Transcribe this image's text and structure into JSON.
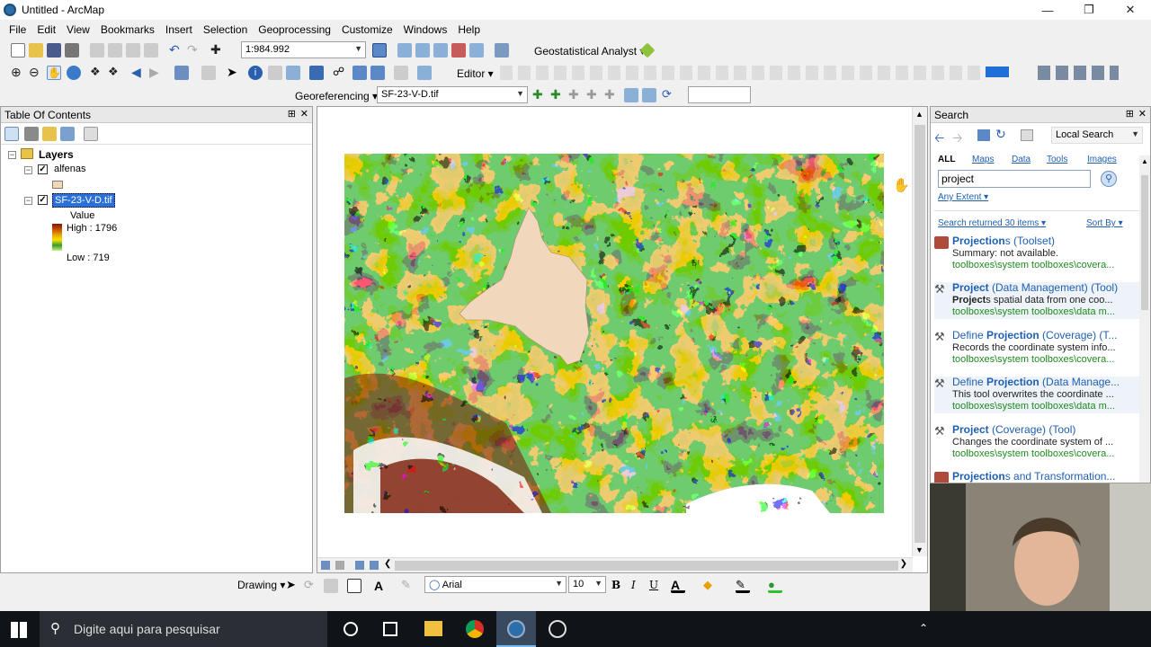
{
  "window": {
    "title": "Untitled - ArcMap"
  },
  "menu": [
    "File",
    "Edit",
    "View",
    "Bookmarks",
    "Insert",
    "Selection",
    "Geoprocessing",
    "Customize",
    "Windows",
    "Help"
  ],
  "toolbar1": {
    "scale": "1:984.992",
    "geostat": "Geostatistical Analyst ▾"
  },
  "toolbar2": {
    "editor": "Editor ▾"
  },
  "toolbar3": {
    "georef_label": "Georeferencing ▾",
    "georef_layer": "SF-23-V-D.tif"
  },
  "toc": {
    "title": "Table Of Contents",
    "root": "Layers",
    "layers": [
      {
        "name": "alfenas"
      },
      {
        "name": "SF-23-V-D.tif",
        "field": "Value",
        "high": "High : 1796",
        "low": "Low : 719"
      }
    ]
  },
  "search": {
    "title": "Search",
    "scope": "Local Search",
    "tabs": [
      "ALL",
      "Maps",
      "Data",
      "Tools",
      "Images"
    ],
    "query": "project",
    "extent": "Any Extent ▾",
    "count": "Search returned 30 items ▾",
    "sort": "Sort By ▾",
    "results": [
      {
        "title_b": "Projection",
        "title_rest": "s (Toolset)",
        "summary": "Summary: not available.",
        "path": "toolboxes\\system toolboxes\\covera..."
      },
      {
        "title_b": "Project",
        "title_rest": " (Data Management) (Tool)",
        "summary_b": "Project",
        "summary": "s spatial data from one coo...",
        "path": "toolboxes\\system toolboxes\\data m..."
      },
      {
        "title_pre": "Define ",
        "title_b": "Projection",
        "title_rest": " (Coverage) (T...",
        "summary": "Records the coordinate system info...",
        "path": "toolboxes\\system toolboxes\\covera..."
      },
      {
        "title_pre": "Define ",
        "title_b": "Projection",
        "title_rest": " (Data Manage...",
        "summary": "This tool overwrites the coordinate ...",
        "path": "toolboxes\\system toolboxes\\data m..."
      },
      {
        "title_b": "Project",
        "title_rest": " (Coverage) (Tool)",
        "summary": "Changes the coordinate system of ...",
        "path": "toolboxes\\system toolboxes\\covera..."
      },
      {
        "title_b": "Projection",
        "title_rest": "s and Transformation..."
      }
    ]
  },
  "drawing": {
    "label": "Drawing ▾",
    "font": "Arial",
    "size": "10",
    "bold": "B",
    "italic": "I",
    "underline": "U"
  },
  "taskbar": {
    "search_placeholder": "Digite aqui para pesquisar"
  },
  "colors": {
    "dem_high": "#7a1a05",
    "dem_mid": "#2f9a28",
    "dem_low": "#f2fbb0",
    "polygon": "#f1d8bd"
  }
}
